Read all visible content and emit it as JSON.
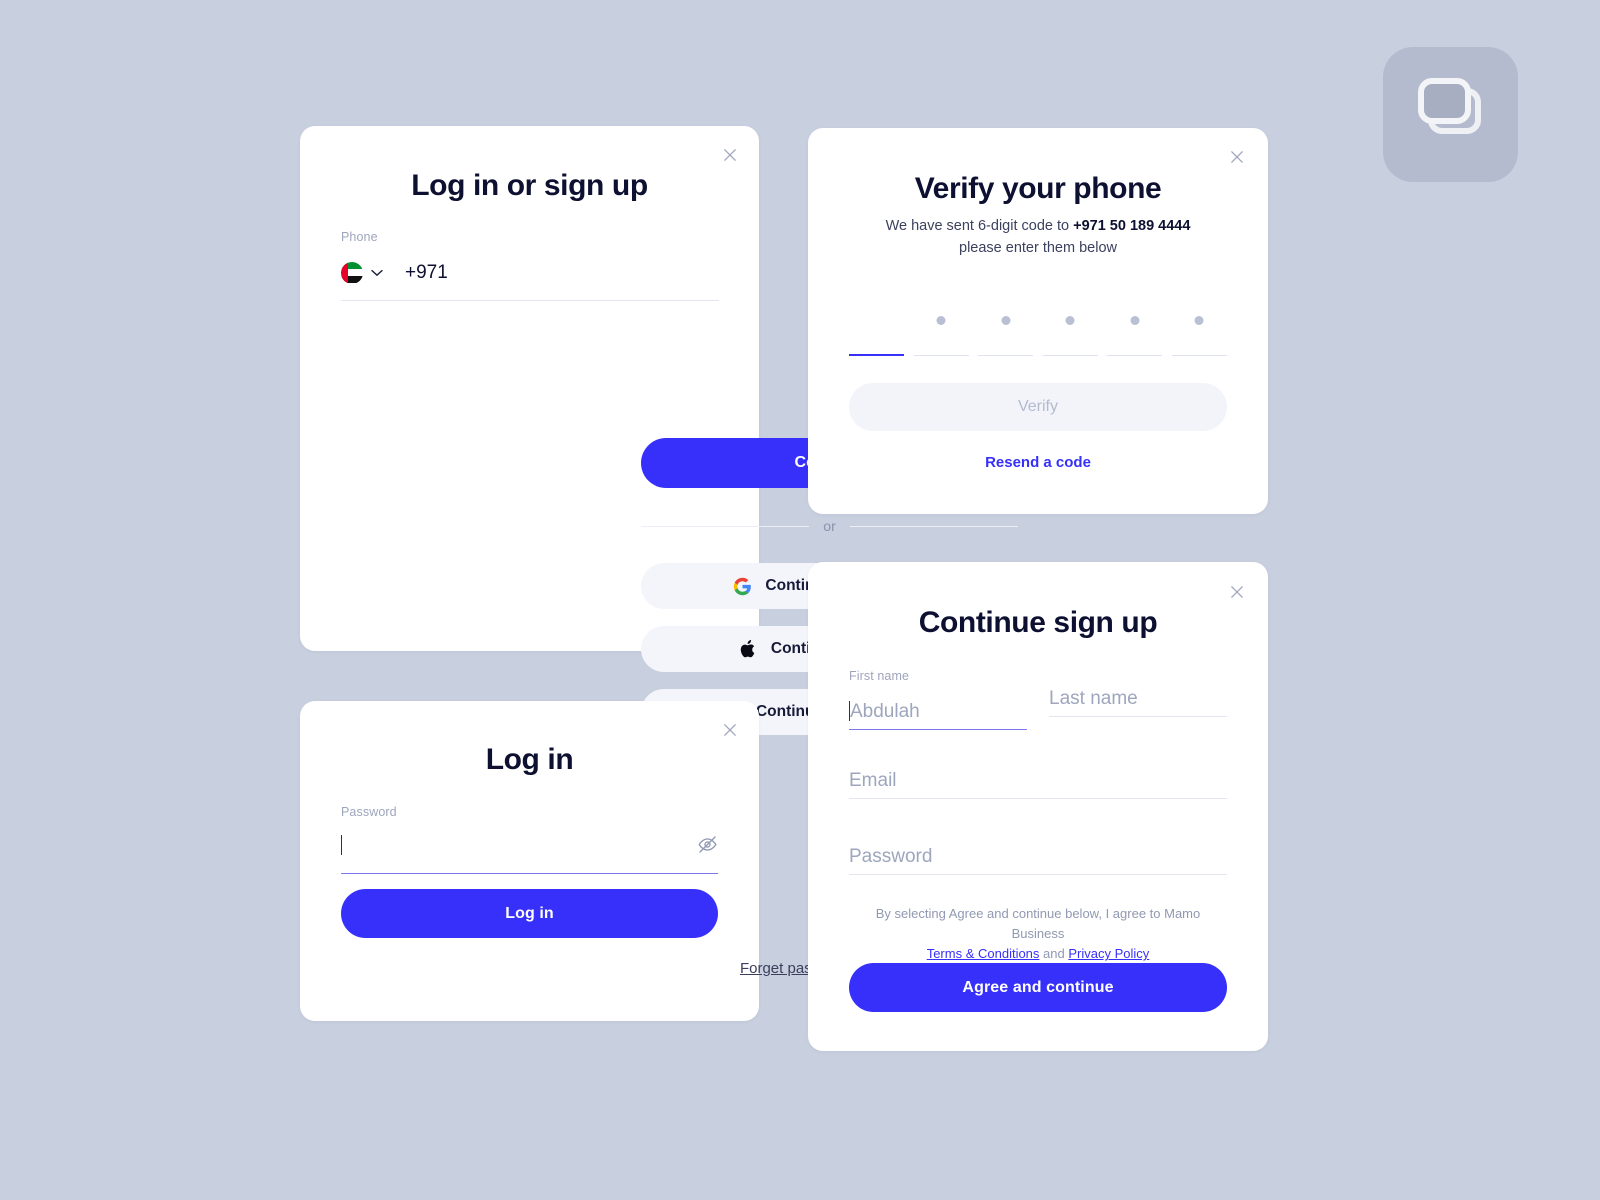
{
  "theme": {
    "background": "#c8cfdf",
    "card_background": "#ffffff",
    "accent": "#3730fb",
    "heading_color": "#0d1030",
    "muted_text": "#9ea6bd",
    "social_button_background": "#f4f5fa",
    "disabled_button_background": "#f2f4f9"
  },
  "badge": {
    "icon": "duplicate-windows-icon"
  },
  "login_signup": {
    "title": "Log in or sign up",
    "close_icon": "close-icon",
    "phone": {
      "label": "Phone",
      "country_flag": "uae-flag-icon",
      "chevron_icon": "chevron-down-icon",
      "value": "+971",
      "placeholder": "+971"
    },
    "continue_label": "Continue",
    "divider_label": "or",
    "social_buttons": [
      {
        "label": "Continue with Google",
        "icon": "google-icon"
      },
      {
        "label": "Continue with Apple",
        "icon": "apple-icon"
      },
      {
        "label": "Continue with Facebook",
        "icon": "facebook-icon"
      }
    ]
  },
  "login": {
    "title": "Log in",
    "close_icon": "close-icon",
    "password": {
      "label": "Password",
      "value": "",
      "placeholder": "",
      "toggle_icon": "eye-off-icon"
    },
    "submit_label": "Log in",
    "forget_label": "Forget password?"
  },
  "verify": {
    "title": "Verify your phone",
    "close_icon": "close-icon",
    "subtitle_prefix": "We have sent 6-digit code to ",
    "subtitle_phone": "+971 50 189 4444",
    "subtitle_suffix": "please enter them below",
    "otp": {
      "length": 6,
      "active_index": 0,
      "cells": [
        "",
        "dot",
        "dot",
        "dot",
        "dot",
        "dot"
      ]
    },
    "verify_label": "Verify",
    "verify_disabled": true,
    "resend_label": "Resend a code"
  },
  "signup": {
    "title": "Continue sign up",
    "close_icon": "close-icon",
    "first_name": {
      "label": "First name",
      "placeholder": "Abdulah",
      "value": ""
    },
    "last_name": {
      "label": "",
      "placeholder": "Last name",
      "value": ""
    },
    "email": {
      "label": "",
      "placeholder": "Email",
      "value": ""
    },
    "password": {
      "label": "",
      "placeholder": "Password",
      "value": ""
    },
    "terms": {
      "lead": "By selecting Agree and continue below, I agree to Mamo Business",
      "terms_link": "Terms & Conditions",
      "conjunction": "and",
      "privacy_link": "Privacy Policy"
    },
    "submit_label": "Agree and continue"
  }
}
